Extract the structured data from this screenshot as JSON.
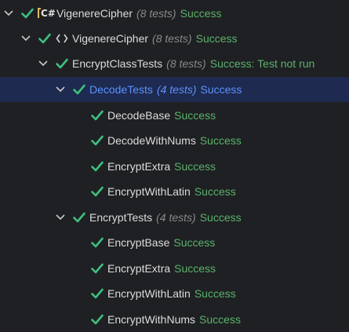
{
  "colors": {
    "background": "#1f2023",
    "selected_row": "#1e2a4f",
    "success_green": "#59b36b",
    "check_green": "#3fbf7f",
    "selected_text": "#5c92ff",
    "count_gray": "#8a8a8a"
  },
  "tree": [
    {
      "name": "VigenereCipher",
      "count": "(8 tests)",
      "status": "Success",
      "icon": "csharp-project-icon",
      "expanded": true,
      "selected": false
    },
    {
      "name": "VigenereCipher",
      "count": "(8 tests)",
      "status": "Success",
      "icon": "namespace-braces-icon",
      "expanded": true,
      "selected": false
    },
    {
      "name": "EncryptClassTests",
      "count": "(8 tests)",
      "status": "Success: Test not run",
      "icon": "",
      "expanded": true,
      "selected": false
    },
    {
      "name": "DecodeTests",
      "count": "(4 tests)",
      "status": "Success",
      "icon": "",
      "expanded": true,
      "selected": true
    },
    {
      "name": "DecodeBase",
      "count": "",
      "status": "Success",
      "icon": "",
      "selected": false
    },
    {
      "name": "DecodeWithNums",
      "count": "",
      "status": "Success",
      "icon": "",
      "selected": false
    },
    {
      "name": "EncryptExtra",
      "count": "",
      "status": "Success",
      "icon": "",
      "selected": false
    },
    {
      "name": "EncryptWithLatin",
      "count": "",
      "status": "Success",
      "icon": "",
      "selected": false
    },
    {
      "name": "EncryptTests",
      "count": "(4 tests)",
      "status": "Success",
      "icon": "",
      "expanded": true,
      "selected": false
    },
    {
      "name": "EncryptBase",
      "count": "",
      "status": "Success",
      "icon": "",
      "selected": false
    },
    {
      "name": "EncryptExtra",
      "count": "",
      "status": "Success",
      "icon": "",
      "selected": false
    },
    {
      "name": "EncryptWithLatin",
      "count": "",
      "status": "Success",
      "icon": "",
      "selected": false
    },
    {
      "name": "EncryptWithNums",
      "count": "",
      "status": "Success",
      "icon": "",
      "selected": false
    }
  ],
  "csharp_icon_text": "C#",
  "namespace_icon_text": "⟨⟩"
}
